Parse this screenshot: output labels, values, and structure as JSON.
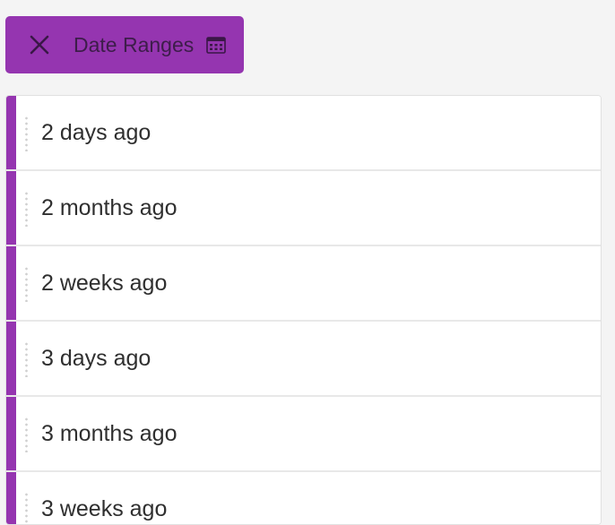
{
  "chip": {
    "label": "Date Ranges",
    "close_icon": "close-icon",
    "calendar_icon": "calendar-icon",
    "color": "#9535b0"
  },
  "list": {
    "items": [
      {
        "label": "2 days ago"
      },
      {
        "label": "2 months ago"
      },
      {
        "label": "2 weeks ago"
      },
      {
        "label": "3 days ago"
      },
      {
        "label": "3 months ago"
      },
      {
        "label": "3 weeks ago"
      }
    ]
  }
}
